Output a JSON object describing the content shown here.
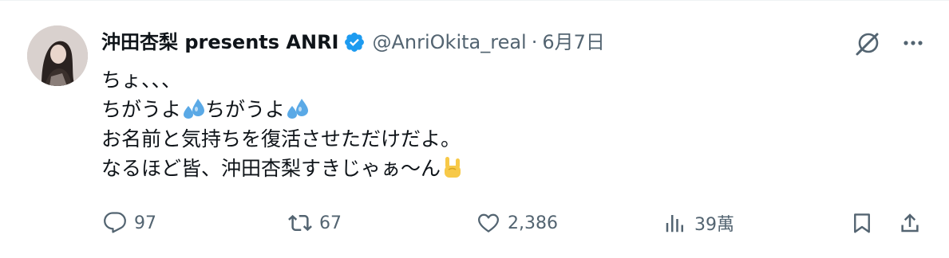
{
  "author": {
    "display_name": "沖田杏梨 presents ANRI",
    "handle": "@AnriOkita_real",
    "separator": "·",
    "date": "6月7日",
    "verified_color": "#1d9bf0"
  },
  "tweet": {
    "lines": [
      "ちょ、、、",
      "ちがうよ",
      "ちがうよ",
      "お名前と気持ちを復活させただけだよ。",
      "なるほど皆、沖田杏梨すきじゃぁ〜ん"
    ],
    "emojis": [
      "sweat-droplets-emoji",
      "sweat-droplets-emoji",
      "sign-of-the-horns-emoji"
    ]
  },
  "actions": {
    "replies": "97",
    "reposts": "67",
    "likes": "2,386",
    "views": "39萬"
  },
  "icons": {
    "grok": "grok-icon",
    "more": "more-icon",
    "reply": "reply-icon",
    "repost": "repost-icon",
    "like": "heart-icon",
    "views": "views-icon",
    "bookmark": "bookmark-icon",
    "share": "share-icon"
  },
  "colors": {
    "text": "#0f1419",
    "secondary": "#536471",
    "accent": "#1d9bf0",
    "emoji_blue": "#5aa9e6",
    "emoji_yellow": "#f7c948"
  }
}
